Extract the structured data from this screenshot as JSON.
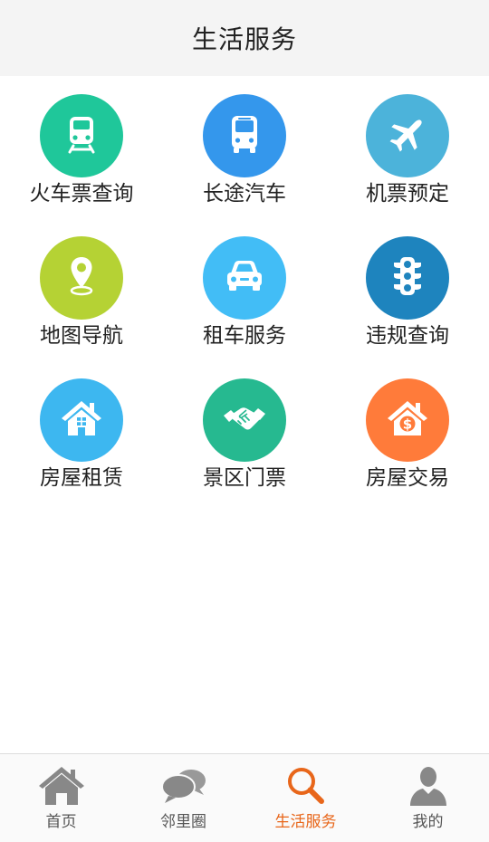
{
  "header": {
    "title": "生活服务"
  },
  "services": [
    {
      "label": "火车票查询",
      "icon": "train-icon",
      "color": "#1fc79a"
    },
    {
      "label": "长途汽车",
      "icon": "bus-icon",
      "color": "#3497ec"
    },
    {
      "label": "机票预定",
      "icon": "airplane-icon",
      "color": "#4cb3da"
    },
    {
      "label": "地图导航",
      "icon": "map-pin-icon",
      "color": "#b5d234"
    },
    {
      "label": "租车服务",
      "icon": "car-icon",
      "color": "#42bdf6"
    },
    {
      "label": "违规查询",
      "icon": "traffic-light-icon",
      "color": "#1e84be"
    },
    {
      "label": "房屋租赁",
      "icon": "house-icon",
      "color": "#3db7f0"
    },
    {
      "label": "景区门票",
      "icon": "handshake-icon",
      "color": "#26b990"
    },
    {
      "label": "房屋交易",
      "icon": "house-dollar-icon",
      "color": "#ff7b3a"
    }
  ],
  "tabbar": {
    "active_color": "#e8661a",
    "inactive_color": "#888888",
    "tabs": [
      {
        "label": "首页",
        "icon": "home-icon",
        "active": false
      },
      {
        "label": "邻里圈",
        "icon": "chat-bubbles-icon",
        "active": false
      },
      {
        "label": "生活服务",
        "icon": "search-icon",
        "active": true
      },
      {
        "label": "我的",
        "icon": "user-icon",
        "active": false
      }
    ]
  }
}
